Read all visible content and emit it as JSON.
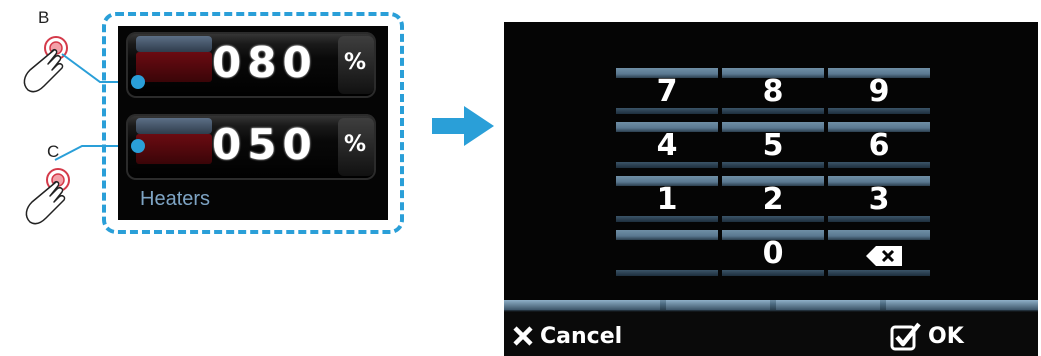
{
  "callouts": {
    "b": "B",
    "c": "C"
  },
  "heater_panel": {
    "bar1_value": "080",
    "bar2_value": "050",
    "unit": "%",
    "label": "Heaters"
  },
  "keypad": {
    "keys": [
      "7",
      "8",
      "9",
      "4",
      "5",
      "6",
      "1",
      "2",
      "3",
      "0"
    ],
    "cancel_label": "Cancel",
    "ok_label": "OK"
  },
  "colors": {
    "accent_blue": "#2a9fd8",
    "key_blue": "#6f8fa6",
    "heater_red": "#6b0b12",
    "label_blue": "#7ea4c4"
  },
  "icons": [
    "hand-pointer-icon",
    "arrow-right-icon",
    "backspace-icon",
    "x-icon",
    "checkbox-icon"
  ]
}
